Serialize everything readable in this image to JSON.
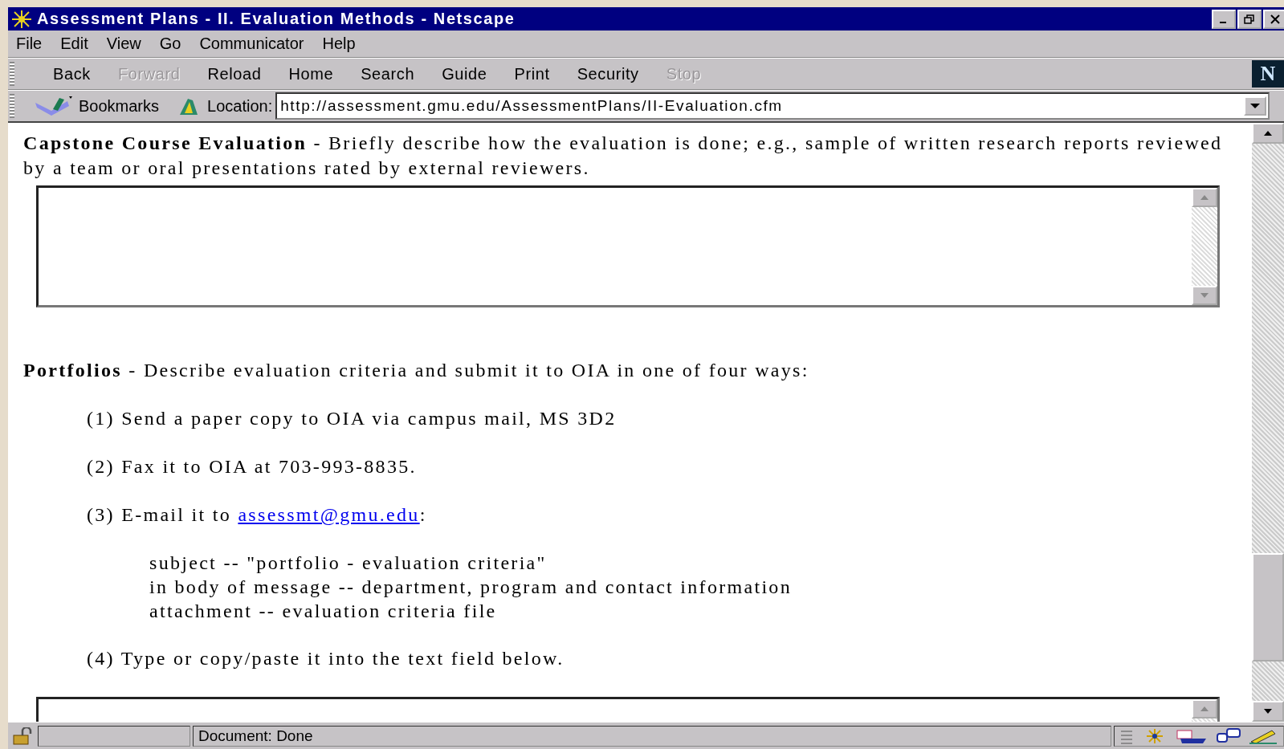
{
  "window": {
    "title": "Assessment Plans - II. Evaluation Methods - Netscape"
  },
  "menu": [
    {
      "label": "File"
    },
    {
      "label": "Edit"
    },
    {
      "label": "View"
    },
    {
      "label": "Go"
    },
    {
      "label": "Communicator"
    },
    {
      "label": "Help"
    }
  ],
  "toolbar": [
    {
      "label": "Back",
      "disabled": false
    },
    {
      "label": "Forward",
      "disabled": true
    },
    {
      "label": "Reload",
      "disabled": false
    },
    {
      "label": "Home",
      "disabled": false
    },
    {
      "label": "Search",
      "disabled": false
    },
    {
      "label": "Guide",
      "disabled": false
    },
    {
      "label": "Print",
      "disabled": false
    },
    {
      "label": "Security",
      "disabled": false
    },
    {
      "label": "Stop",
      "disabled": true
    }
  ],
  "logo_letter": "N",
  "location_bar": {
    "bookmarks": "Bookmarks",
    "label": "Location:",
    "url": "http://assessment.gmu.edu/AssessmentPlans/II-Evaluation.cfm"
  },
  "content": {
    "capstone": "**Capstone Course Evaluation** - Briefly describe how the evaluation is done; e.g., sample of written research reports reviewed by a team or oral presentations rated by external reviewers.",
    "portfolios": "**Portfolios** - Describe evaluation criteria and submit it to OIA in one of four ways:",
    "ways": [
      {
        "kind": "text",
        "text": "(1) Send a paper copy to OIA via campus mail, MS 3D2"
      },
      {
        "kind": "text",
        "text": "(2) Fax it to OIA at 703-993-8835."
      },
      {
        "kind": "email",
        "text_before": "(3) E-mail it to ",
        "link": "assessmt@gmu.edu",
        "text_after": ":",
        "details": [
          "subject -- \"portfolio - evaluation criteria\"",
          "in body of message -- department, program and contact information",
          "attachment -- evaluation criteria file"
        ]
      },
      {
        "kind": "text",
        "text": "(4) Type or copy/paste it into the text field below."
      }
    ]
  },
  "status_bar": {
    "text": "Document: Done"
  }
}
